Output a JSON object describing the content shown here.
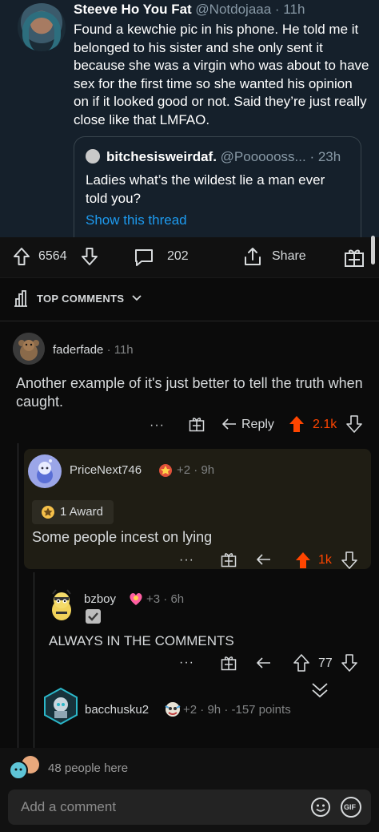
{
  "tweet": {
    "author_name": "Steeve Ho You Fat",
    "author_handle": "@Notdojaaa",
    "time": "· 11h",
    "text": "Found a kewchie pic in his phone. He told me it belonged to his sister and she only sent it because she was a virgin who was about to have sex for the first time so she wanted his opinion on if it looked good or not. Said they’re just really close like that LMFAO.",
    "quote": {
      "author_name": "bitchesisweirdaf.",
      "author_handle": "@Poooooss...",
      "time": "· 23h",
      "text": "Ladies what’s the wildest lie a man ever told you?",
      "link": "Show this thread"
    }
  },
  "post_actions": {
    "score": "6564",
    "comments": "202",
    "share": "Share"
  },
  "sort": {
    "label": "TOP COMMENTS"
  },
  "comments": [
    {
      "user": "faderfade",
      "time": "· 11h",
      "text": "Another example of it's just better to tell the truth when caught.",
      "more": "···",
      "reply": "Reply",
      "score": "2.1k"
    },
    {
      "user": "PriceNext746",
      "awards_count": "+2",
      "time": "· 9h",
      "award_label": "1 Award",
      "text": "Some people incest on lying",
      "more": "···",
      "score": "1k"
    },
    {
      "user": "bzboy",
      "awards_count": "+3",
      "time": "· 6h",
      "text": "ALWAYS IN THE COMMENTS",
      "more": "···",
      "score": "77"
    },
    {
      "user": "bacchusku2",
      "awards_count": "+2",
      "time": "· 9h",
      "points": "· -157 points"
    }
  ],
  "footer": {
    "people_here": "48 people here",
    "add_comment_placeholder": "Add a comment",
    "gif_label": "GIF"
  },
  "colors": {
    "tweet_bg": "#15202b",
    "link_blue": "#1d9bf0",
    "upvote_orange": "#ff4500",
    "app_bg": "#0b0b0b"
  }
}
